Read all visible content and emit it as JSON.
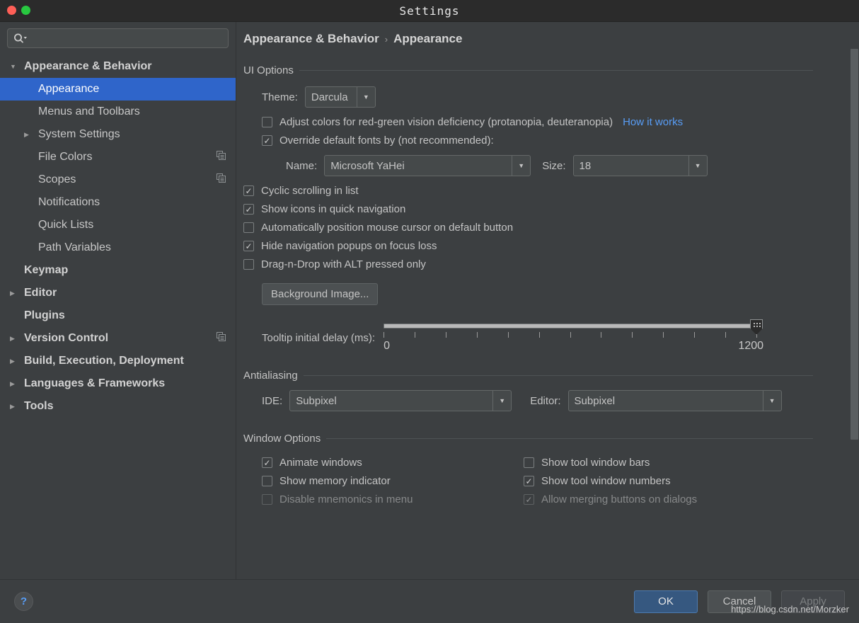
{
  "window": {
    "title": "Settings",
    "traffic_lights": [
      "close",
      "minimize-hidden",
      "maximize"
    ]
  },
  "sidebar": {
    "search": {
      "value": "",
      "placeholder": ""
    },
    "items": [
      {
        "label": "Appearance & Behavior",
        "level": 0,
        "expandable": true,
        "expanded": true,
        "selected": false,
        "group": true,
        "copy_icon": false
      },
      {
        "label": "Appearance",
        "level": 1,
        "expandable": false,
        "expanded": false,
        "selected": true,
        "group": false,
        "copy_icon": false
      },
      {
        "label": "Menus and Toolbars",
        "level": 1,
        "expandable": false,
        "expanded": false,
        "selected": false,
        "group": false,
        "copy_icon": false
      },
      {
        "label": "System Settings",
        "level": 1,
        "expandable": true,
        "expanded": false,
        "selected": false,
        "group": false,
        "copy_icon": false
      },
      {
        "label": "File Colors",
        "level": 1,
        "expandable": false,
        "expanded": false,
        "selected": false,
        "group": false,
        "copy_icon": true
      },
      {
        "label": "Scopes",
        "level": 1,
        "expandable": false,
        "expanded": false,
        "selected": false,
        "group": false,
        "copy_icon": true
      },
      {
        "label": "Notifications",
        "level": 1,
        "expandable": false,
        "expanded": false,
        "selected": false,
        "group": false,
        "copy_icon": false
      },
      {
        "label": "Quick Lists",
        "level": 1,
        "expandable": false,
        "expanded": false,
        "selected": false,
        "group": false,
        "copy_icon": false
      },
      {
        "label": "Path Variables",
        "level": 1,
        "expandable": false,
        "expanded": false,
        "selected": false,
        "group": false,
        "copy_icon": false
      },
      {
        "label": "Keymap",
        "level": 0,
        "expandable": false,
        "expanded": false,
        "selected": false,
        "group": true,
        "copy_icon": false
      },
      {
        "label": "Editor",
        "level": 0,
        "expandable": true,
        "expanded": false,
        "selected": false,
        "group": true,
        "copy_icon": false
      },
      {
        "label": "Plugins",
        "level": 0,
        "expandable": false,
        "expanded": false,
        "selected": false,
        "group": true,
        "copy_icon": false
      },
      {
        "label": "Version Control",
        "level": 0,
        "expandable": true,
        "expanded": false,
        "selected": false,
        "group": true,
        "copy_icon": true
      },
      {
        "label": "Build, Execution, Deployment",
        "level": 0,
        "expandable": true,
        "expanded": false,
        "selected": false,
        "group": true,
        "copy_icon": false
      },
      {
        "label": "Languages & Frameworks",
        "level": 0,
        "expandable": true,
        "expanded": false,
        "selected": false,
        "group": true,
        "copy_icon": false
      },
      {
        "label": "Tools",
        "level": 0,
        "expandable": true,
        "expanded": false,
        "selected": false,
        "group": true,
        "copy_icon": false
      }
    ]
  },
  "breadcrumb": {
    "parent": "Appearance & Behavior",
    "separator": "›",
    "current": "Appearance"
  },
  "ui_options": {
    "section_label": "UI Options",
    "theme_label": "Theme:",
    "theme_value": "Darcula",
    "adjust_colors": {
      "label": "Adjust colors for red-green vision deficiency (protanopia, deuteranopia)",
      "checked": false,
      "link": "How it works"
    },
    "override_fonts": {
      "label": "Override default fonts by (not recommended):",
      "checked": true
    },
    "font_name_label": "Name:",
    "font_name_value": "Microsoft YaHei",
    "font_size_label": "Size:",
    "font_size_value": "18",
    "checkboxes": [
      {
        "label": "Cyclic scrolling in list",
        "checked": true
      },
      {
        "label": "Show icons in quick navigation",
        "checked": true
      },
      {
        "label": "Automatically position mouse cursor on default button",
        "checked": false
      },
      {
        "label": "Hide navigation popups on focus loss",
        "checked": true
      },
      {
        "label": "Drag-n-Drop with ALT pressed only",
        "checked": false
      }
    ],
    "background_image_button": "Background Image...",
    "tooltip_delay": {
      "label": "Tooltip initial delay (ms):",
      "min_label": "0",
      "max_label": "1200",
      "min": 0,
      "max": 1200,
      "value": 1200,
      "tick_count": 13
    }
  },
  "antialiasing": {
    "section_label": "Antialiasing",
    "ide_label": "IDE:",
    "ide_value": "Subpixel",
    "editor_label": "Editor:",
    "editor_value": "Subpixel"
  },
  "window_options": {
    "section_label": "Window Options",
    "left": [
      {
        "label": "Animate windows",
        "checked": true
      },
      {
        "label": "Show memory indicator",
        "checked": false
      },
      {
        "label": "Disable mnemonics in menu",
        "checked": false
      }
    ],
    "right": [
      {
        "label": "Show tool window bars",
        "checked": false
      },
      {
        "label": "Show tool window numbers",
        "checked": true
      },
      {
        "label": "Allow merging buttons on dialogs",
        "checked": true
      }
    ]
  },
  "footer": {
    "help": "?",
    "ok": "OK",
    "cancel": "Cancel",
    "apply": "Apply"
  },
  "watermark": "https://blog.csdn.net/Morzker",
  "colors": {
    "background": "#3c3f41",
    "titlebar": "#2b2b2b",
    "selection": "#2f65ca",
    "accent_link": "#589df6",
    "ok_button": "#365880",
    "text": "#c4c4c4"
  }
}
